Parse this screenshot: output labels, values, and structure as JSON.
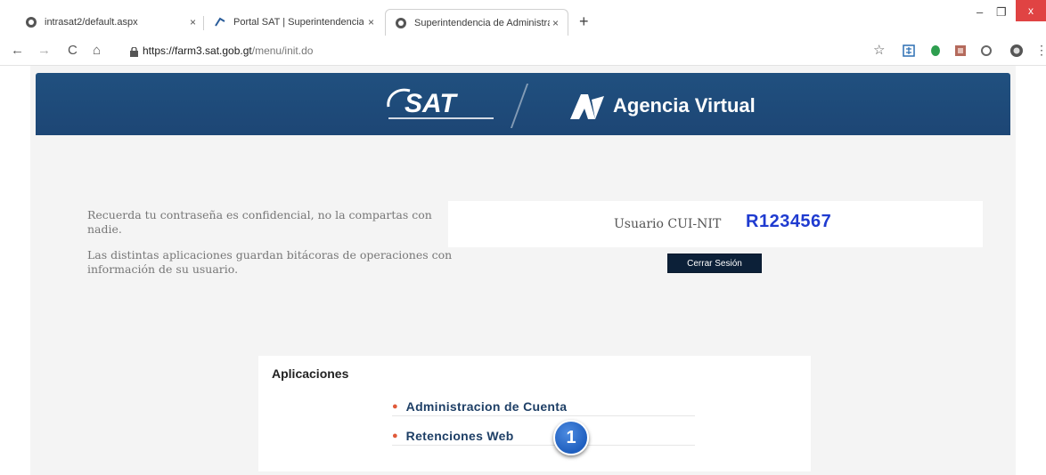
{
  "browser": {
    "tabs": [
      {
        "title": "intrasat2/default.aspx",
        "close": "×"
      },
      {
        "title": "Portal SAT | Superintendencia de",
        "close": "×"
      },
      {
        "title": "Superintendencia de Administrac",
        "close": "×"
      }
    ],
    "new_tab": "+",
    "window": {
      "minimize": "–",
      "restore": "❐",
      "close": "x"
    },
    "nav": {
      "back": "←",
      "forward": "→",
      "reload": "C",
      "home": "⌂"
    },
    "url_host": "https://farm3.sat.gob.gt",
    "url_path": "/menu/init.do",
    "bookmark_star": "☆",
    "menu_dots": "⋮"
  },
  "banner": {
    "logo_text": "SAT",
    "title": "Agencia Virtual"
  },
  "info": {
    "line1": "Recuerda tu contraseña es confidencial, no la compartas con nadie.",
    "line2": "Las distintas aplicaciones guardan bitácoras de operaciones con información de su usuario."
  },
  "user": {
    "label": "Usuario CUI-NIT",
    "value": "R1234567",
    "logout_label": "Cerrar Sesión"
  },
  "apps": {
    "title": "Aplicaciones",
    "items": [
      {
        "label": "Administracion de Cuenta"
      },
      {
        "label": "Retenciones Web"
      }
    ],
    "step_badge": "1"
  },
  "colors": {
    "banner": "#20507f",
    "link": "#1e3f66",
    "user_value": "#1f3bd0",
    "logout_bg": "#0c2038",
    "bullet": "#e05a3a",
    "badge": "#1f5fbf"
  }
}
